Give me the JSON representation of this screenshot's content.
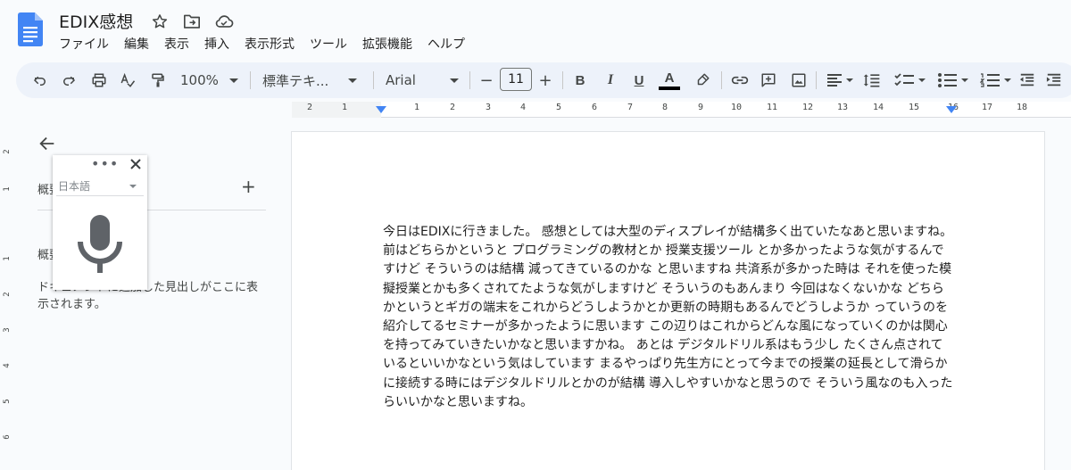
{
  "app": {
    "title": "EDIX感想",
    "icons": [
      "star-icon",
      "move-to-folder-icon",
      "cloud-saved-icon"
    ]
  },
  "menu": [
    "ファイル",
    "編集",
    "表示",
    "挿入",
    "表示形式",
    "ツール",
    "拡張機能",
    "ヘルプ"
  ],
  "toolbar": {
    "zoom": "100%",
    "style": "標準テキ...",
    "font": "Arial",
    "font_size": "11",
    "minus": "−",
    "plus": "+",
    "bold": "B",
    "italic": "I",
    "underline": "U",
    "text_color_letter": "A",
    "text_color": "#000000"
  },
  "ruler": {
    "numbers": [
      "2",
      "1",
      "1",
      "2",
      "3",
      "4",
      "5",
      "6",
      "7",
      "8",
      "9",
      "10",
      "11",
      "12",
      "13",
      "14",
      "15",
      "16",
      "17",
      "18"
    ]
  },
  "vertical_ruler": {
    "numbers": [
      "2",
      "1",
      "1",
      "2",
      "3",
      "4",
      "5",
      "6"
    ]
  },
  "outline": {
    "tab_label": "概要",
    "add_label": "+",
    "section_label": "概要",
    "hint": "ドキュメントに追加した見出しがここに表示されます。"
  },
  "voice_typing": {
    "menu_label": "•••",
    "language": "日本語"
  },
  "document": {
    "body": "今日はEDIXに行きました。 感想としては大型のディスプレイが結構多く出ていたなあと思いますね。 前はどちらかというと プログラミングの教材とか 授業支援ツール とか多かったような気がするんですけど そういうのは結構 減ってきているのかな と思いますね 共済系が多かった時は それを使った模擬授業とかも多くされてたような気がしますけど そういうのもあんまり 今回はなくないかな どちらかというとギガの端末をこれからどうしようかとか更新の時期もあるんでどうしようか っていうのを紹介してるセミナーが多かったように思います この辺りはこれからどんな風になっていくのかは関心を持ってみていきたいかなと思いますかね。 あとは デジタルドリル系はもう少し たくさん点されているといいかなという気はしています まるやっぱり先生方にとって今までの授業の延長として滑らかに接続する時にはデジタルドリルとかのが結構 導入しやすいかなと思うので そういう風なのも入ったらいいかなと思いますね。"
  }
}
